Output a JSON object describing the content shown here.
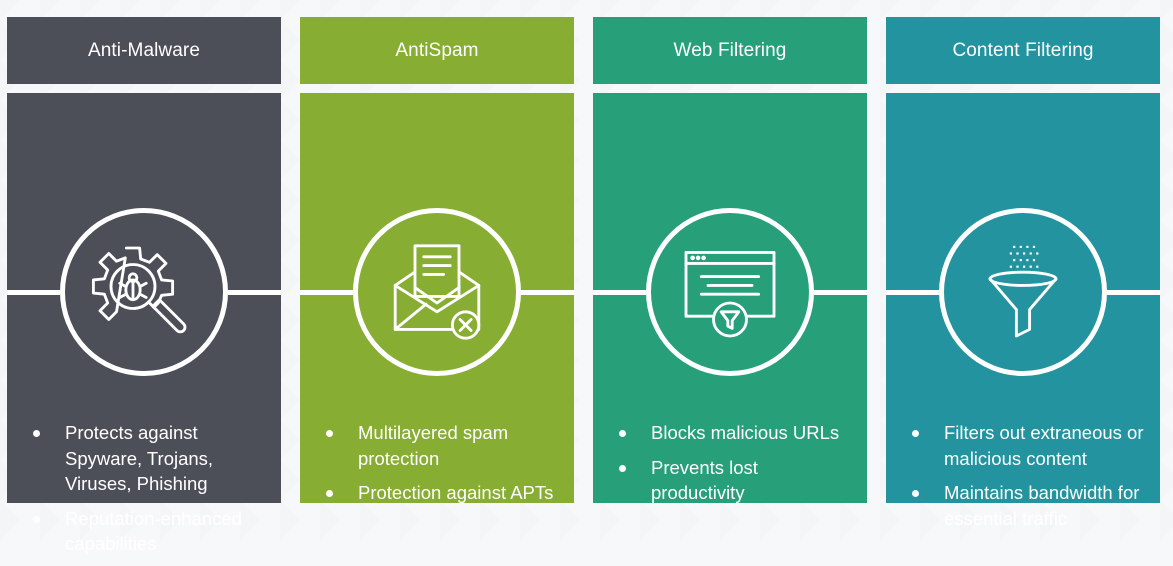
{
  "colors": {
    "anti_malware_header": "#4c4f58",
    "anti_malware_body": "#4c4f58",
    "antispam_header": "#87ad33",
    "antispam_body": "#87ad33",
    "web_filtering_header": "#27a07a",
    "web_filtering_body": "#27a07a",
    "content_filtering_header": "#23939f",
    "content_filtering_body": "#23939f"
  },
  "columns": [
    {
      "title": "Anti-Malware",
      "icon": "gear-bug-magnifier-icon",
      "bullets": [
        "Protects against Spyware, Trojans, Viruses, Phishing",
        "Reputation-enhanced capabilities"
      ]
    },
    {
      "title": "AntiSpam",
      "icon": "envelope-block-icon",
      "bullets": [
        "Multilayered spam protection",
        "Protection against APTs"
      ]
    },
    {
      "title": "Web Filtering",
      "icon": "browser-filter-icon",
      "bullets": [
        "Blocks malicious URLs",
        "Prevents lost productivity"
      ]
    },
    {
      "title": "Content Filtering",
      "icon": "funnel-icon",
      "bullets": [
        "Filters out extraneous or malicious content",
        "Maintains bandwidth for essential traffic"
      ]
    }
  ]
}
